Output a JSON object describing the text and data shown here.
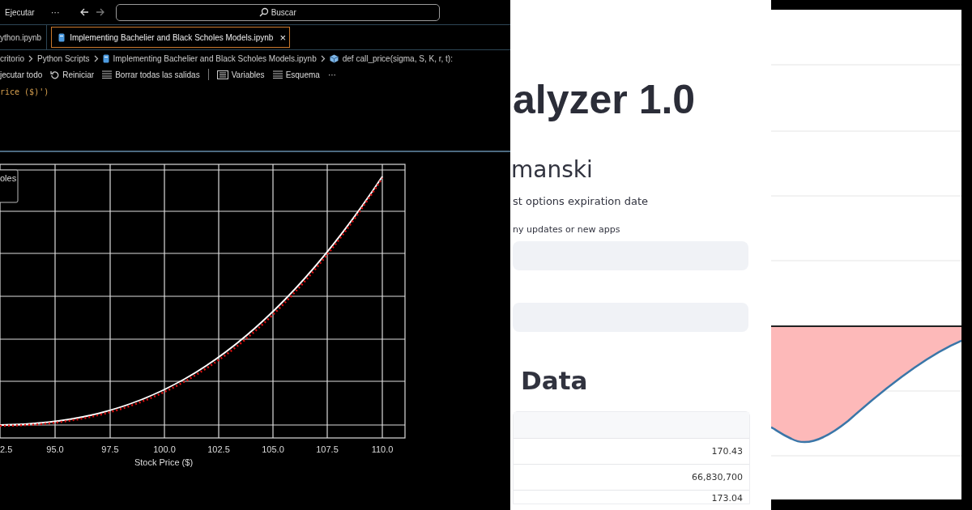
{
  "ide": {
    "run_menu": "Ejecutar",
    "more": "···",
    "search": {
      "placeholder": "Buscar"
    },
    "tabs": [
      {
        "label": "ython.ipynb",
        "selected": false
      },
      {
        "label": "Implementing Bachelier and Black Scholes Models.ipynb",
        "selected": true,
        "close": "×"
      }
    ],
    "breadcrumbs": [
      {
        "label": "critorio",
        "kind": "folder"
      },
      {
        "label": "Python Scripts",
        "kind": "folder"
      },
      {
        "label": "Implementing Bachelier and Black Scholes Models.ipynb",
        "kind": "file"
      },
      {
        "label": "def call_price(sigma, S, K, r, t):",
        "kind": "symbol"
      }
    ],
    "notebook_toolbar": [
      {
        "label": "jecutar todo",
        "kind": "plain",
        "divider_before": false
      },
      {
        "label": "Reiniciar",
        "kind": "restart",
        "divider_before": false
      },
      {
        "label": "Borrar todas las salidas",
        "kind": "clear",
        "divider_before": false
      },
      {
        "label": "Variables",
        "kind": "variables",
        "divider_before": true
      },
      {
        "label": "Esquema",
        "kind": "outline",
        "divider_before": false
      },
      {
        "label": "···",
        "kind": "more",
        "divider_before": false
      }
    ],
    "code_line": "rice ($)')",
    "plot": {
      "legend": "oles",
      "xticks": [
        "2.5",
        "95.0",
        "97.5",
        "100.0",
        "102.5",
        "105.0",
        "107.5",
        "110.0"
      ],
      "xlabel": "Stock Price ($)"
    }
  },
  "app": {
    "title": "alyzer 1.0",
    "subtitle": "manski",
    "description": "st options expiration date",
    "note": "ny updates or new apps",
    "fields": [
      {
        "kind": "input"
      },
      {
        "kind": "input"
      }
    ],
    "section_heading": "Data",
    "table": {
      "rows": [
        {
          "value": "170.43"
        },
        {
          "value": "66,830,700"
        },
        {
          "value": "173.04"
        }
      ]
    }
  }
}
